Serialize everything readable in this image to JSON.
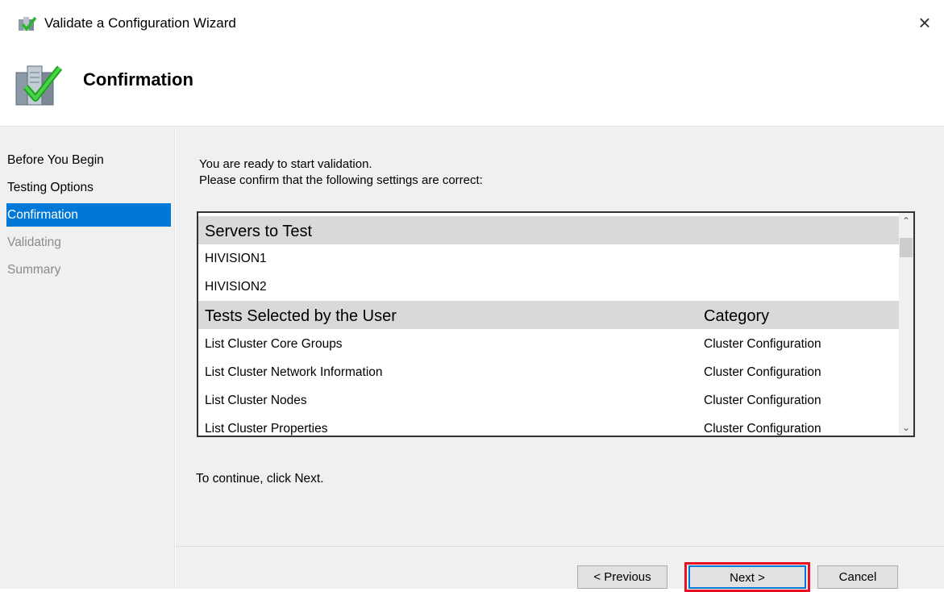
{
  "window": {
    "title": "Validate a Configuration Wizard",
    "close_glyph": "×",
    "icon": "cluster-wizard-icon"
  },
  "header": {
    "title": "Confirmation",
    "icon": "servers-checkmark-icon"
  },
  "sidebar": {
    "items": [
      {
        "label": "Before You Begin",
        "state": "done"
      },
      {
        "label": "Testing Options",
        "state": "done"
      },
      {
        "label": "Confirmation",
        "state": "active"
      },
      {
        "label": "Validating",
        "state": "disabled"
      },
      {
        "label": "Summary",
        "state": "disabled"
      }
    ]
  },
  "main": {
    "intro_line1": "You are ready to start validation.",
    "intro_line2": "Please confirm that the following settings are correct:",
    "continue_text": "To continue, click Next."
  },
  "listbox": {
    "servers_header": "Servers to Test",
    "servers": [
      "HIVISION1",
      "HIVISION2"
    ],
    "tests_header": "Tests Selected by the User",
    "category_header": "Category",
    "tests": [
      {
        "name": "List Cluster Core Groups",
        "category": "Cluster Configuration"
      },
      {
        "name": "List Cluster Network Information",
        "category": "Cluster Configuration"
      },
      {
        "name": "List Cluster Nodes",
        "category": "Cluster Configuration"
      },
      {
        "name": "List Cluster Properties",
        "category": "Cluster Configuration"
      }
    ],
    "scroll_up_glyph": "⌃",
    "scroll_down_glyph": "⌄"
  },
  "buttons": {
    "previous": "< Previous",
    "next": "Next >",
    "cancel": "Cancel"
  },
  "colors": {
    "active_nav": "#0078d7",
    "highlight_box": "#e81123"
  }
}
